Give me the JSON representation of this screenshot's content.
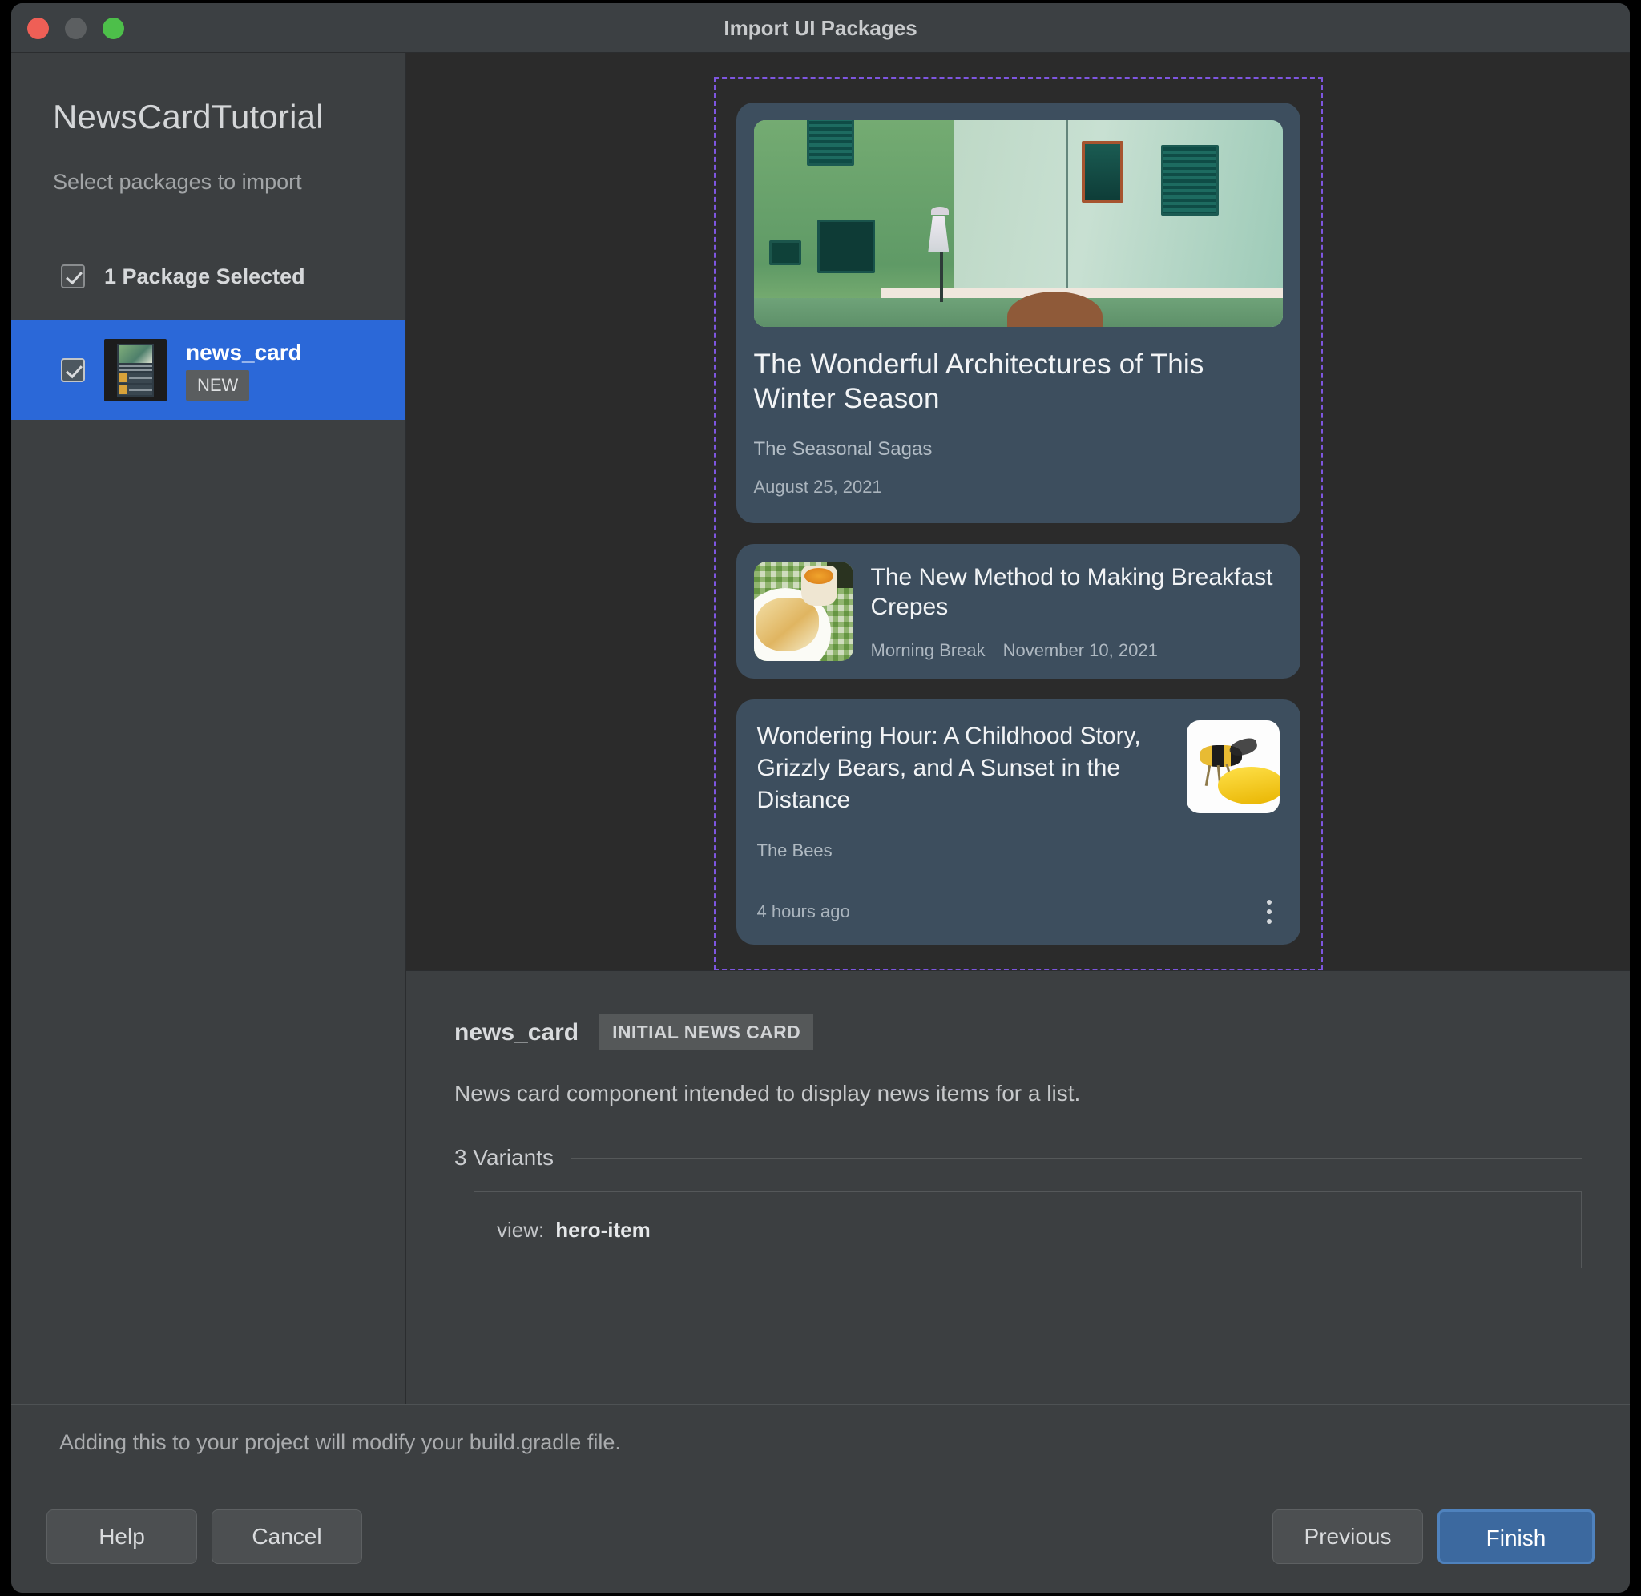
{
  "window": {
    "title": "Import UI Packages",
    "traffic_lights": [
      "close-button",
      "minimize-button",
      "zoom-button"
    ]
  },
  "sidebar": {
    "project_title": "NewsCardTutorial",
    "subtitle": "Select packages to import",
    "selected_summary": "1 Package Selected",
    "packages": [
      {
        "name": "news_card",
        "badge": "NEW",
        "checked": true,
        "selected": true
      }
    ]
  },
  "preview": {
    "cards": [
      {
        "variant": "hero",
        "title": "The Wonderful Architectures of This Winter Season",
        "source": "The Seasonal Sagas",
        "date": "August 25, 2021"
      },
      {
        "variant": "list-item",
        "title": "The New Method to Making Breakfast Crepes",
        "source": "Morning Break",
        "date": "November 10, 2021"
      },
      {
        "variant": "expanded",
        "title": "Wondering Hour: A Childhood Story, Grizzly Bears, and A Sunset in the Distance",
        "source": "The Bees",
        "time": "4 hours ago",
        "overflow_icon": "more-vertical-icon"
      }
    ],
    "selection_outline_color": "#7e56e0"
  },
  "details": {
    "name": "news_card",
    "badge": "INITIAL NEWS CARD",
    "description": "News card component intended to display news items for a list.",
    "variants_label": "3 Variants",
    "variant_rows": [
      {
        "key": "view:",
        "value": "hero-item"
      }
    ]
  },
  "note": {
    "text": "Adding this to your project will modify your build.gradle file."
  },
  "footer": {
    "help_label": "Help",
    "cancel_label": "Cancel",
    "previous_label": "Previous",
    "finish_label": "Finish",
    "primary_color": "#3c699f"
  }
}
